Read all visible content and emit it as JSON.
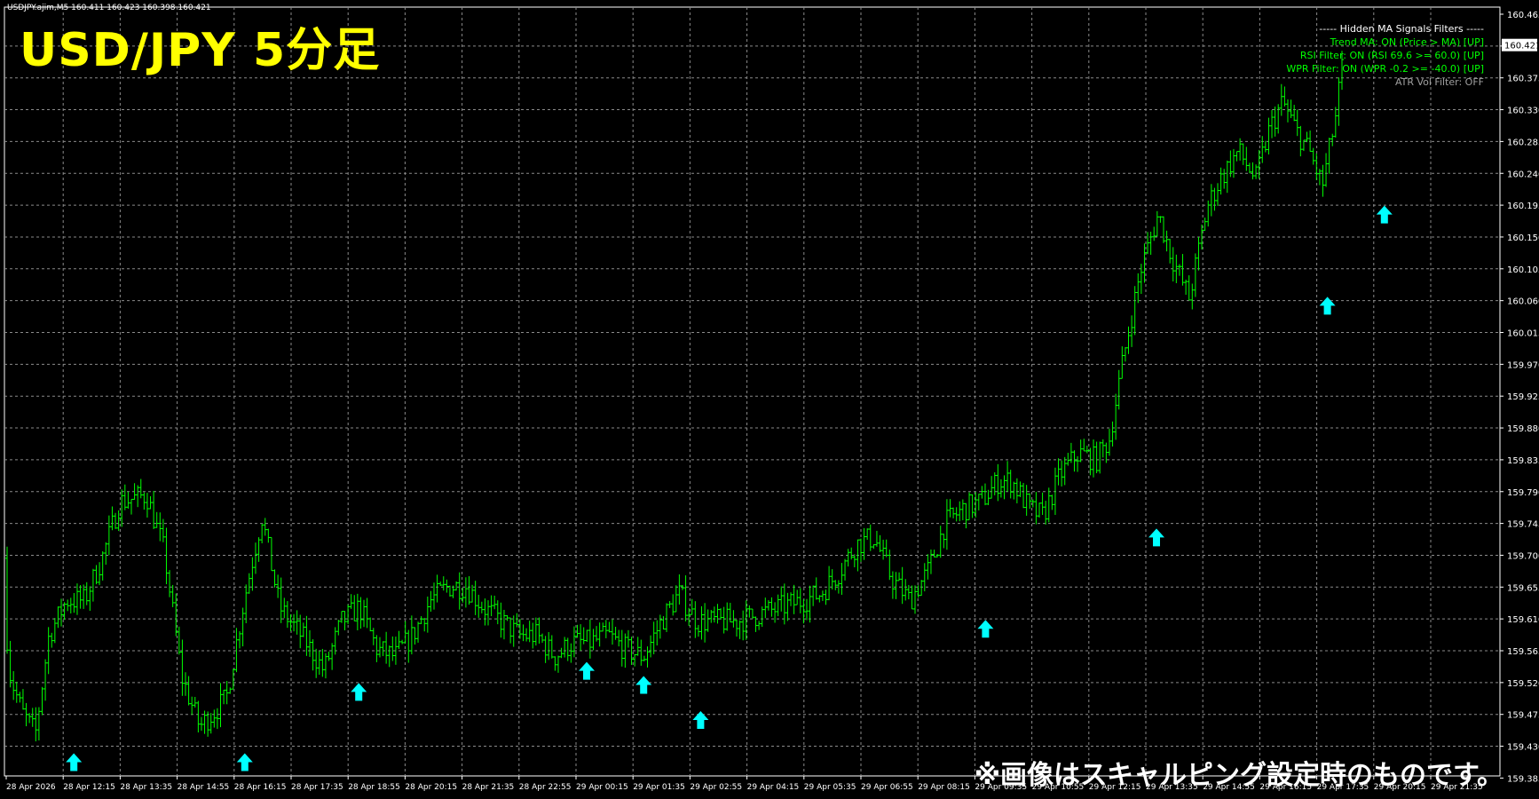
{
  "header": {
    "symbol_line": "USDJPY.ajim,M5  160.411 160.423 160.398 160.421",
    "overlay_title": "USD/JPY 5分足",
    "bottom_note": "※画像はスキャルピング設定時のものです。"
  },
  "indicator_panel": {
    "title": "----- Hidden MA Signals Filters -----",
    "lines": [
      {
        "text": "Trend MA: ON (Price > MA) [UP]",
        "color": "#00ff00"
      },
      {
        "text": "RSI Filter: ON (RSI 69.6 >= 60.0) [UP]",
        "color": "#00ff00"
      },
      {
        "text": "WPR Filter: ON (WPR -0.2 >= -40.0) [UP]",
        "color": "#00ff00"
      },
      {
        "text": "ATR Vol Filter: OFF",
        "color": "#a0a0a0"
      }
    ]
  },
  "colors": {
    "background": "#000000",
    "grid": "#8a8a8a",
    "bars": "#00ff00",
    "arrow": "#00ffff",
    "text": "#ffffff",
    "title": "#ffff00",
    "current_price_bg": "#ffffff"
  },
  "chart_data": {
    "type": "ohlc",
    "price_labels": [
      "160.465",
      "160.421",
      "160.375",
      "160.330",
      "160.285",
      "160.240",
      "160.195",
      "160.150",
      "160.105",
      "160.060",
      "160.015",
      "159.970",
      "159.925",
      "159.880",
      "159.835",
      "159.790",
      "159.745",
      "159.700",
      "159.655",
      "159.610",
      "159.565",
      "159.520",
      "159.475",
      "159.430",
      "159.385"
    ],
    "current_price": "160.421",
    "time_labels": [
      "28 Apr 2026",
      "28 Apr 12:15",
      "28 Apr 13:35",
      "28 Apr 14:55",
      "28 Apr 16:15",
      "28 Apr 17:35",
      "28 Apr 18:55",
      "28 Apr 20:15",
      "28 Apr 21:35",
      "28 Apr 22:55",
      "29 Apr 00:15",
      "29 Apr 01:35",
      "29 Apr 02:55",
      "29 Apr 04:15",
      "29 Apr 05:35",
      "29 Apr 06:55",
      "29 Apr 08:15",
      "29 Apr 09:35",
      "29 Apr 10:55",
      "29 Apr 12:15",
      "29 Apr 13:35",
      "29 Apr 14:55",
      "29 Apr 16:15",
      "29 Apr 17:35",
      "29 Apr 20:15",
      "29 Apr 21:35"
    ],
    "ylim": [
      159.38,
      160.475
    ],
    "bar_count": 420,
    "price_path": [
      [
        0,
        159.69
      ],
      [
        12,
        159.52
      ],
      [
        25,
        159.47
      ],
      [
        40,
        159.44
      ],
      [
        55,
        159.58
      ],
      [
        75,
        159.63
      ],
      [
        95,
        159.63
      ],
      [
        115,
        159.69
      ],
      [
        135,
        159.77
      ],
      [
        165,
        159.78
      ],
      [
        185,
        159.7
      ],
      [
        205,
        159.52
      ],
      [
        225,
        159.45
      ],
      [
        255,
        159.49
      ],
      [
        275,
        159.63
      ],
      [
        295,
        159.75
      ],
      [
        315,
        159.62
      ],
      [
        345,
        159.57
      ],
      [
        365,
        159.53
      ],
      [
        385,
        159.6
      ],
      [
        405,
        159.62
      ],
      [
        425,
        159.56
      ],
      [
        445,
        159.55
      ],
      [
        465,
        159.58
      ],
      [
        485,
        159.63
      ],
      [
        505,
        159.65
      ],
      [
        525,
        159.65
      ],
      [
        545,
        159.62
      ],
      [
        565,
        159.6
      ],
      [
        585,
        159.58
      ],
      [
        605,
        159.58
      ],
      [
        625,
        159.55
      ],
      [
        645,
        159.57
      ],
      [
        665,
        159.57
      ],
      [
        685,
        159.58
      ],
      [
        705,
        159.56
      ],
      [
        725,
        159.55
      ],
      [
        745,
        159.6
      ],
      [
        765,
        159.64
      ],
      [
        785,
        159.6
      ],
      [
        805,
        159.6
      ],
      [
        830,
        159.6
      ],
      [
        855,
        159.61
      ],
      [
        880,
        159.62
      ],
      [
        905,
        159.63
      ],
      [
        925,
        159.64
      ],
      [
        945,
        159.67
      ],
      [
        965,
        159.71
      ],
      [
        985,
        159.72
      ],
      [
        1005,
        159.66
      ],
      [
        1025,
        159.63
      ],
      [
        1045,
        159.67
      ],
      [
        1065,
        159.74
      ],
      [
        1085,
        159.76
      ],
      [
        1105,
        159.77
      ],
      [
        1125,
        159.8
      ],
      [
        1140,
        159.8
      ],
      [
        1160,
        159.76
      ],
      [
        1175,
        159.75
      ],
      [
        1195,
        159.81
      ],
      [
        1215,
        159.84
      ],
      [
        1235,
        159.83
      ],
      [
        1250,
        159.86
      ],
      [
        1265,
        159.97
      ],
      [
        1285,
        160.1
      ],
      [
        1305,
        160.18
      ],
      [
        1320,
        160.12
      ],
      [
        1340,
        160.06
      ],
      [
        1360,
        160.19
      ],
      [
        1375,
        160.23
      ],
      [
        1395,
        160.27
      ],
      [
        1415,
        160.23
      ],
      [
        1430,
        160.3
      ],
      [
        1445,
        160.34
      ],
      [
        1460,
        160.3
      ],
      [
        1475,
        160.27
      ],
      [
        1490,
        160.22
      ],
      [
        1505,
        160.32
      ],
      [
        1515,
        160.42
      ]
    ],
    "signals": [
      {
        "time_index": 1,
        "price": 159.43
      },
      {
        "time_index": 4,
        "price": 159.43
      },
      {
        "time_index": 6,
        "price": 159.53
      },
      {
        "time_index": 10,
        "price": 159.56
      },
      {
        "time_index": 11,
        "price": 159.54
      },
      {
        "time_index": 12,
        "price": 159.49
      },
      {
        "time_index": 17,
        "price": 159.62
      },
      {
        "time_index": 20,
        "price": 159.75
      },
      {
        "time_index": 23,
        "price": 160.08
      },
      {
        "time_index": 24,
        "price": 160.21
      }
    ]
  }
}
